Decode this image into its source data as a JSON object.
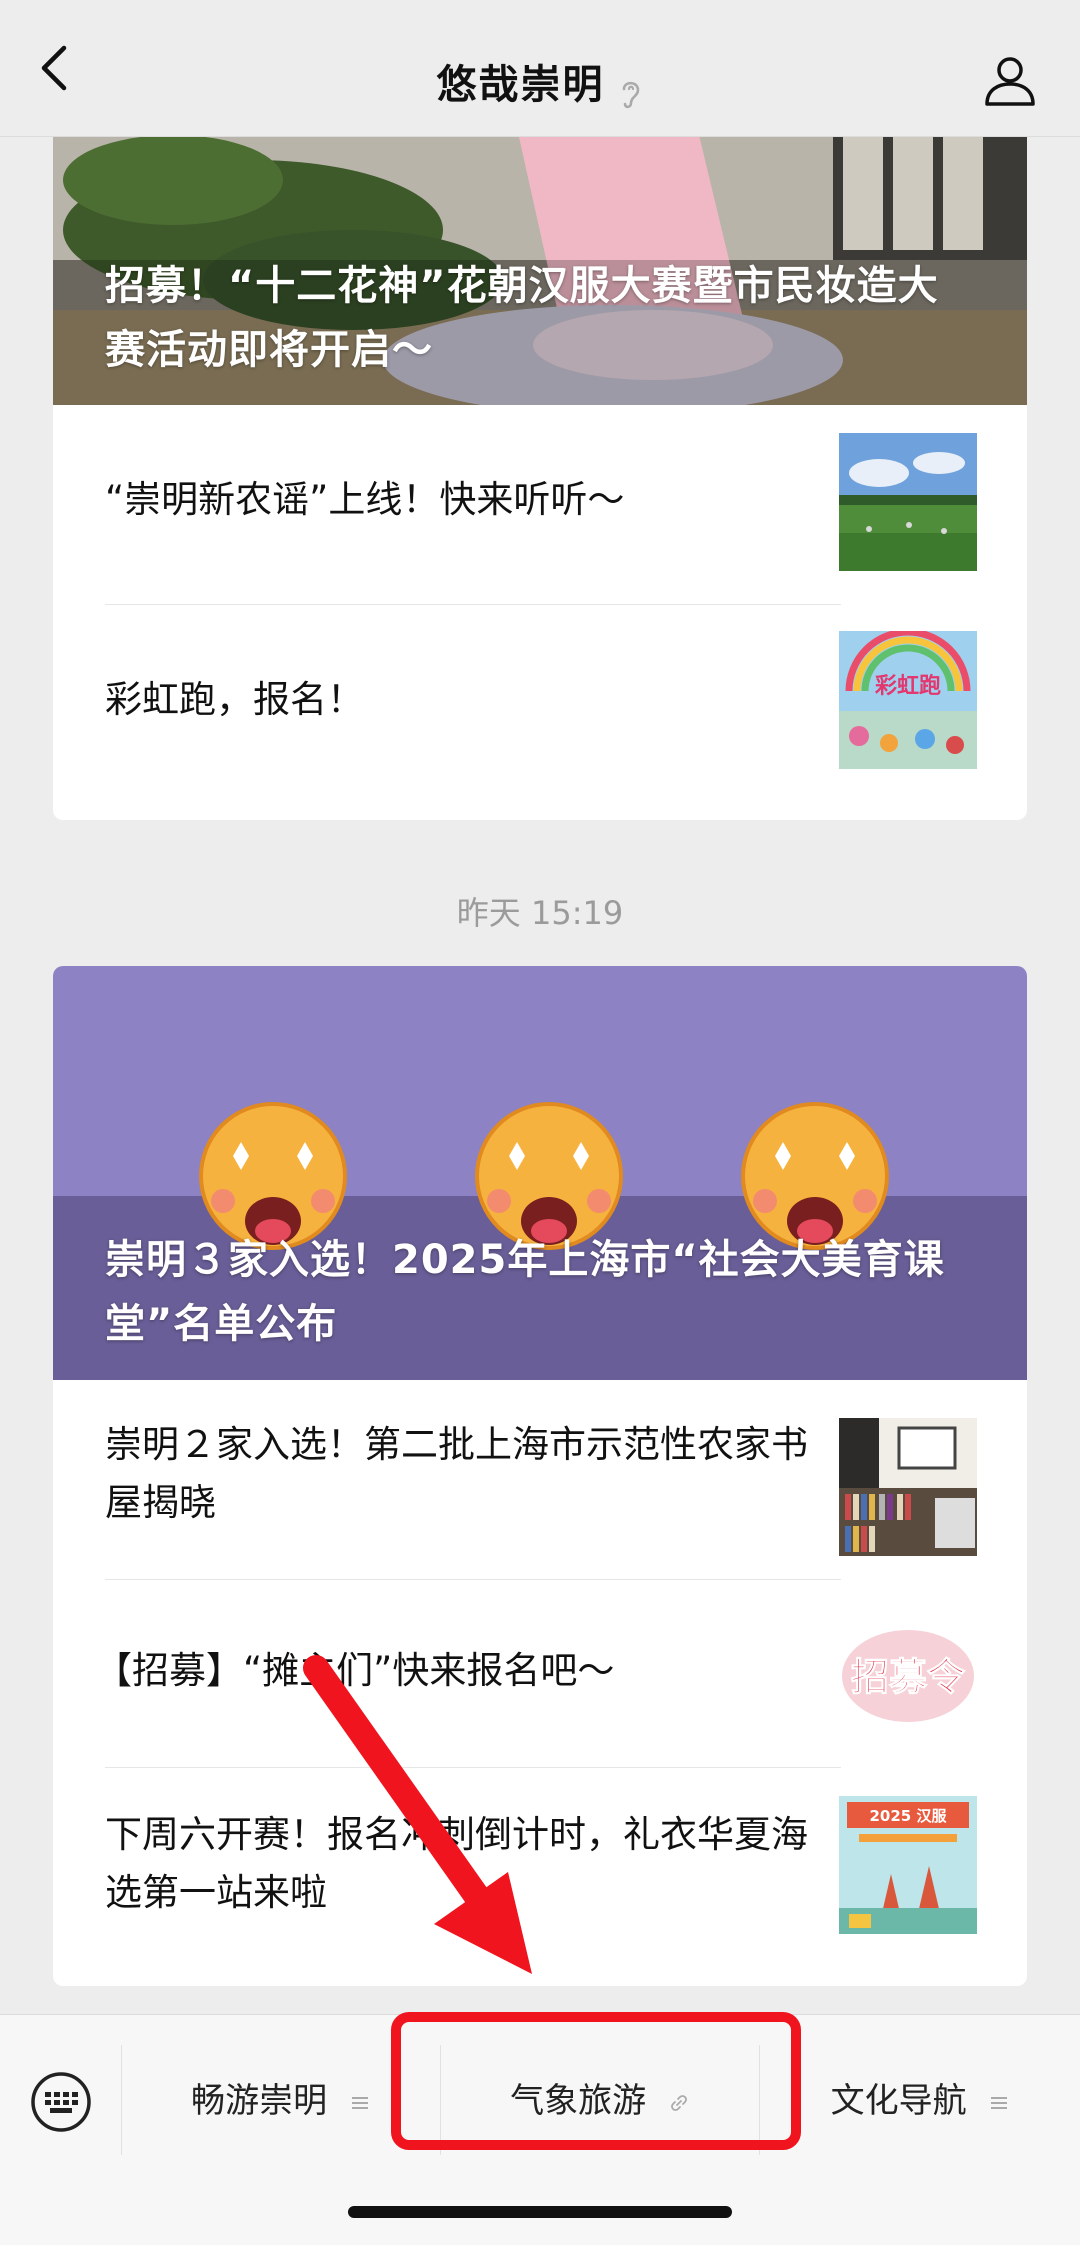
{
  "header": {
    "title": "悠哉崇明"
  },
  "feed": [
    {
      "hero_title": "招募！“十二花神”花朝汉服大赛暨市民妆造大赛活动即将开启～",
      "items": [
        {
          "title": "“崇明新农谣”上线！快来听听～"
        },
        {
          "title": "彩虹跑，报名！",
          "thumb_text": "彩虹跑"
        }
      ]
    },
    {
      "timestamp": "昨天 15:19",
      "hero_title": "崇明３家入选！2025年上海市“社会大美育课堂”名单公布",
      "items": [
        {
          "title": "崇明２家入选！第二批上海市示范性农家书屋揭晓"
        },
        {
          "title": "【招募】“摊主们”快来报名吧～",
          "thumb_text": "招募令"
        },
        {
          "title": "下周六开赛！报名冲刺倒计时，礼衣华夏海选第一站来啦",
          "thumb_text": "2025 汉服"
        }
      ]
    }
  ],
  "menu": [
    {
      "label": "畅游崇明"
    },
    {
      "label": "气象旅游"
    },
    {
      "label": "文化导航"
    }
  ],
  "colors": {
    "highlight": "#f0141e",
    "background": "#ededed",
    "hero_purple": "#8c82c4"
  }
}
